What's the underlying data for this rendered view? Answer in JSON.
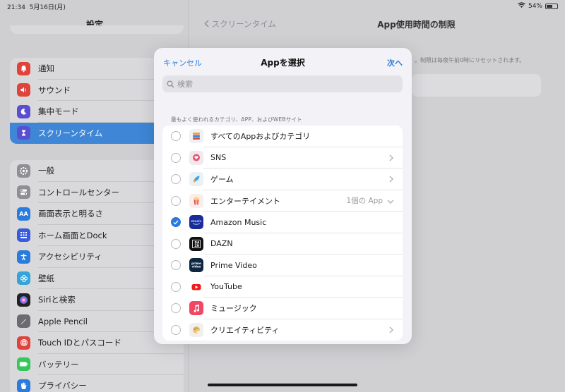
{
  "status": {
    "time": "21:34",
    "date": "5月16日(月)",
    "battery": "54%"
  },
  "sidebar": {
    "title": "設定",
    "group1": [
      {
        "label": "通知",
        "icon": "bell-icon",
        "color": "#e0433b"
      },
      {
        "label": "サウンド",
        "icon": "speaker-icon",
        "color": "#e0433b"
      },
      {
        "label": "集中モード",
        "icon": "moon-icon",
        "color": "#5b4fd1"
      },
      {
        "label": "スクリーンタイム",
        "icon": "hourglass-icon",
        "color": "#5b4fd1"
      }
    ],
    "group2": [
      {
        "label": "一般",
        "icon": "gear-icon",
        "color": "#8e8e93"
      },
      {
        "label": "コントロールセンター",
        "icon": "toggles-icon",
        "color": "#8e8e93"
      },
      {
        "label": "画面表示と明るさ",
        "icon": "text-size-icon",
        "color": "#2a7bdc",
        "glyph": "AA"
      },
      {
        "label": "ホーム画面とDock",
        "icon": "grid-icon",
        "color": "#3a5bd9"
      },
      {
        "label": "アクセシビリティ",
        "icon": "accessibility-icon",
        "color": "#2a7bdc"
      },
      {
        "label": "壁紙",
        "icon": "flower-icon",
        "color": "#36a3d9"
      },
      {
        "label": "Siriと検索",
        "icon": "siri-icon",
        "color": "#222"
      },
      {
        "label": "Apple Pencil",
        "icon": "pencil-icon",
        "color": "#6c6c70"
      },
      {
        "label": "Touch IDとパスコード",
        "icon": "fingerprint-icon",
        "color": "#e0433b"
      },
      {
        "label": "バッテリー",
        "icon": "battery-icon",
        "color": "#34c759"
      },
      {
        "label": "プライバシー",
        "icon": "hand-icon",
        "color": "#2a7bdc"
      }
    ]
  },
  "detail": {
    "back_label": "スクリーンタイム",
    "title": "App使用時間の制限",
    "note": "。制限は毎夜午前0時にリセットされます。"
  },
  "modal": {
    "cancel_label": "キャンセル",
    "title": "Appを選択",
    "next_label": "次へ",
    "search_placeholder": "検索",
    "section_header": "最もよく使われるカテゴリ、APP、およびWEBサイト",
    "items": [
      {
        "name": "すべてのAppおよびカテゴリ",
        "checked": false,
        "icon": "stack-icon",
        "chevron": "none",
        "extra": ""
      },
      {
        "name": "SNS",
        "checked": false,
        "icon": "chat-bubble-icon",
        "chevron": "right",
        "extra": ""
      },
      {
        "name": "ゲーム",
        "checked": false,
        "icon": "rocket-icon",
        "chevron": "right",
        "extra": ""
      },
      {
        "name": "エンターテイメント",
        "checked": false,
        "icon": "popcorn-icon",
        "chevron": "down",
        "extra": "1個の App"
      },
      {
        "name": "Amazon Music",
        "checked": true,
        "icon": "amazon-music-icon",
        "chevron": "none",
        "extra": ""
      },
      {
        "name": "DAZN",
        "checked": false,
        "icon": "dazn-icon",
        "chevron": "none",
        "extra": ""
      },
      {
        "name": "Prime Video",
        "checked": false,
        "icon": "prime-video-icon",
        "chevron": "none",
        "extra": ""
      },
      {
        "name": "YouTube",
        "checked": false,
        "icon": "youtube-icon",
        "chevron": "none",
        "extra": ""
      },
      {
        "name": "ミュージック",
        "checked": false,
        "icon": "music-note-icon",
        "chevron": "none",
        "extra": ""
      },
      {
        "name": "クリエイティビティ",
        "checked": false,
        "icon": "palette-icon",
        "chevron": "right",
        "extra": ""
      }
    ]
  }
}
